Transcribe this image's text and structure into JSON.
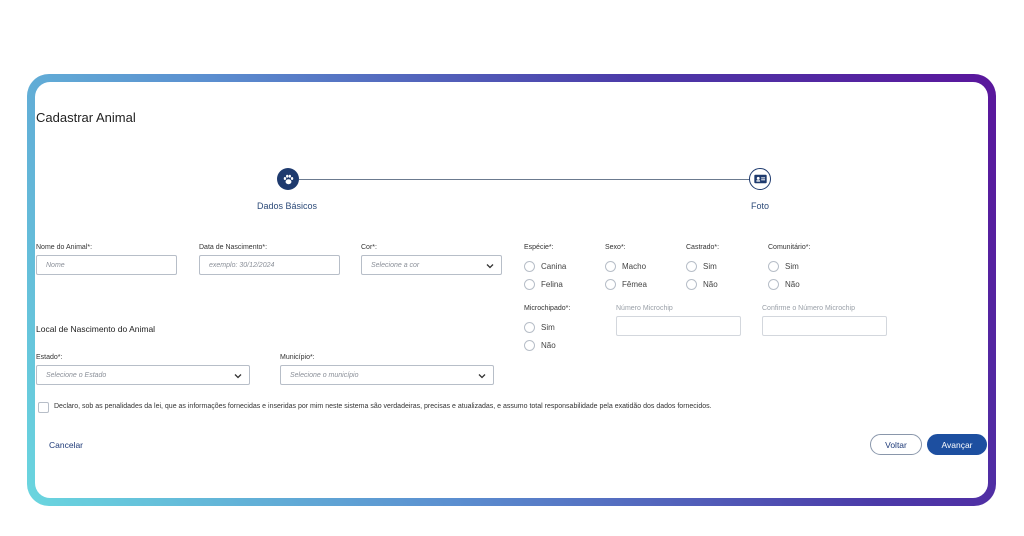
{
  "title": "Cadastrar Animal",
  "stepper": {
    "steps": [
      {
        "label": "Dados Básicos",
        "icon": "paw-icon",
        "active": true
      },
      {
        "label": "Foto",
        "icon": "id-card-icon",
        "active": false
      }
    ]
  },
  "fields": {
    "nome": {
      "label": "Nome do Animal*:",
      "placeholder": "Nome"
    },
    "nascimento": {
      "label": "Data de Nascimento*:",
      "placeholder": "exemplo: 30/12/2024"
    },
    "cor": {
      "label": "Cor*:",
      "placeholder": "Selecione a cor"
    },
    "estado": {
      "label": "Estado*:",
      "placeholder": "Selecione o Estado"
    },
    "municipio": {
      "label": "Município*:",
      "placeholder": "Selecione o município"
    },
    "numero_microchip": {
      "label": "Número Microchip"
    },
    "confirme_microchip": {
      "label": "Confirme o Número Microchip"
    }
  },
  "radio_groups": {
    "especie": {
      "label": "Espécie*:",
      "options": [
        "Canina",
        "Felina"
      ]
    },
    "sexo": {
      "label": "Sexo*:",
      "options": [
        "Macho",
        "Fêmea"
      ]
    },
    "castrado": {
      "label": "Castrado*:",
      "options": [
        "Sim",
        "Não"
      ]
    },
    "comunitario": {
      "label": "Comunitário*:",
      "options": [
        "Sim",
        "Não"
      ]
    },
    "microchipado": {
      "label": "Microchipado*:",
      "options": [
        "Sim",
        "Não"
      ]
    }
  },
  "section": {
    "local_nascimento": "Local de Nascimento do Animal"
  },
  "declaration": "Declaro, sob as penalidades da lei, que as informações fornecidas e inseridas por mim neste sistema são verdadeiras, precisas e atualizadas, e assumo total responsabilidade pela exatidão dos dados fornecidos.",
  "actions": {
    "cancel": "Cancelar",
    "back": "Voltar",
    "next": "Avançar"
  },
  "colors": {
    "primary": "#1d4fa0",
    "step_active": "#1e3a6e",
    "link": "#1e3a78"
  }
}
